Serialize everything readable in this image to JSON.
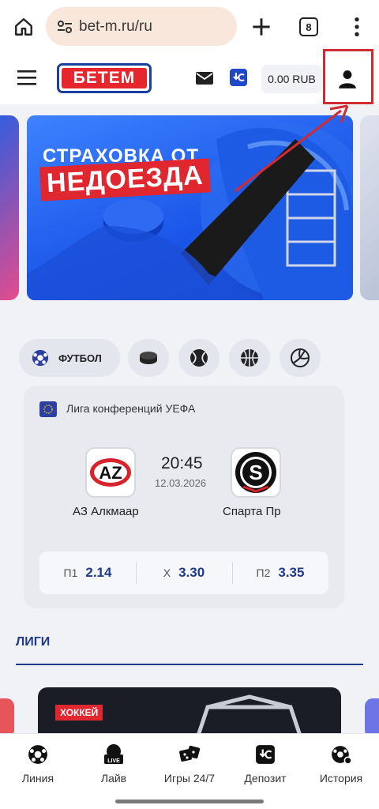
{
  "browser": {
    "url": "bet-m.ru/ru",
    "tab_count": "8"
  },
  "header": {
    "logo_text": "БЕТЕМ",
    "balance": "0.00 RUB"
  },
  "banner": {
    "line1": "СТРАХОВКА ОТ",
    "line2": "НЕДОЕЗДА"
  },
  "sports": {
    "active_label": "ФУТБОЛ",
    "icons": [
      "football-icon",
      "hockey-puck-icon",
      "tennis-ball-icon",
      "basketball-icon",
      "volleyball-icon"
    ]
  },
  "match": {
    "league": "Лига конференций УЕФА",
    "home_logo": "AZ",
    "away_logo": "S",
    "home_team": "АЗ Алкмаар",
    "away_team": "Спарта Пр",
    "time": "20:45",
    "date": "12.03.2026",
    "odds": [
      {
        "label": "П1",
        "value": "2.14"
      },
      {
        "label": "Х",
        "value": "3.30"
      },
      {
        "label": "П2",
        "value": "3.35"
      }
    ]
  },
  "leagues": {
    "title": "ЛИГИ",
    "card_tag": "ХОККЕЙ"
  },
  "nav": [
    {
      "label": "Линия",
      "icon": "football-icon"
    },
    {
      "label": "Лайв",
      "icon": "live-icon"
    },
    {
      "label": "Игры 24/7",
      "icon": "dice-icon"
    },
    {
      "label": "Депозит",
      "icon": "deposit-icon"
    },
    {
      "label": "История",
      "icon": "history-icon"
    }
  ],
  "colors": {
    "brand_red": "#e5262c",
    "brand_blue": "#1f3a8a",
    "highlight": "#d02b30"
  }
}
